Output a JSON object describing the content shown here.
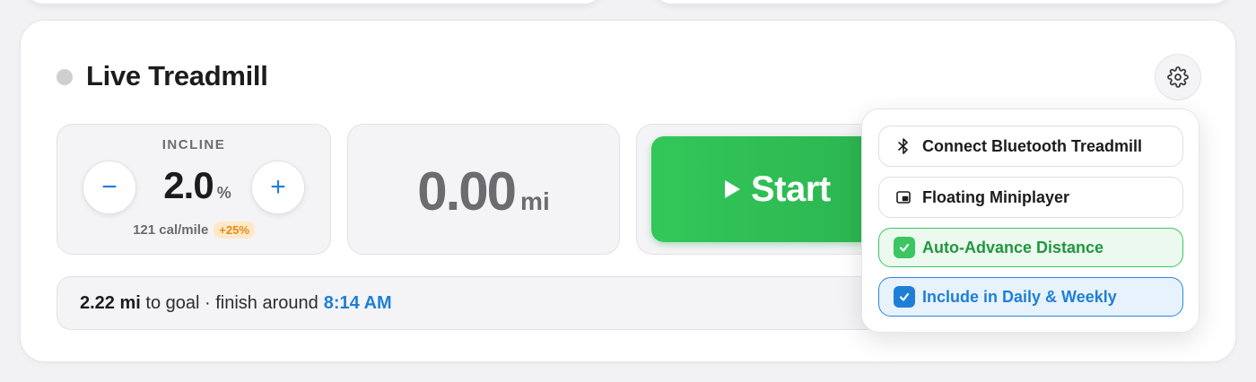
{
  "card": {
    "title": "Live Treadmill"
  },
  "incline": {
    "label": "INCLINE",
    "minus": "−",
    "plus": "+",
    "value": "2.0",
    "unit": "%",
    "calories": "121 cal/mile",
    "boost": "+25%"
  },
  "distance": {
    "value": "0.00",
    "unit": "mi"
  },
  "start": {
    "label": "Start"
  },
  "goal": {
    "remaining": "2.22 mi",
    "text": "to goal · finish around",
    "time": "8:14 AM"
  },
  "menu": {
    "items": [
      {
        "label": "Connect Bluetooth Treadmill",
        "icon": "bluetooth-icon"
      },
      {
        "label": "Floating Miniplayer",
        "icon": "picture-in-picture-icon"
      },
      {
        "label": "Auto-Advance Distance",
        "checked": true,
        "color": "#3cc563"
      },
      {
        "label": "Include in Daily & Weekly",
        "checked": true,
        "color": "#1e7fd6"
      }
    ]
  },
  "colors": {
    "accent": "#1e7fd6",
    "start_green": "#33c759",
    "boost_orange": "#e88a12"
  }
}
